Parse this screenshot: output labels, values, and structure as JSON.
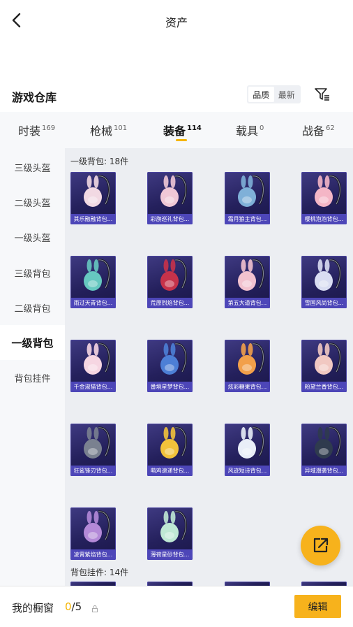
{
  "header": {
    "title": "资产"
  },
  "section": {
    "title": "游戏仓库",
    "sort_options": [
      {
        "label": "品质",
        "active": true
      },
      {
        "label": "最新",
        "active": false
      }
    ]
  },
  "tabs": [
    {
      "label": "时装",
      "count": "169"
    },
    {
      "label": "枪械",
      "count": "101"
    },
    {
      "label": "装备",
      "count": "114",
      "active": true
    },
    {
      "label": "载具",
      "count": "0"
    },
    {
      "label": "战备",
      "count": "62"
    }
  ],
  "sidebar": [
    {
      "label": "三级头盔"
    },
    {
      "label": "二级头盔"
    },
    {
      "label": "一级头盔"
    },
    {
      "label": "三级背包"
    },
    {
      "label": "二级背包"
    },
    {
      "label": "一级背包",
      "active": true
    },
    {
      "label": "背包挂件"
    }
  ],
  "groups": {
    "backpacks": {
      "label": "一级背包: 18件",
      "items": [
        {
          "name": "其乐融融背包...",
          "accent": "#f2d9e3"
        },
        {
          "name": "彩旗巡礼背包...",
          "accent": "#f0c8d6"
        },
        {
          "name": "霜月狼主背包...",
          "accent": "#7fb0d8"
        },
        {
          "name": "樱桃泡泡背包...",
          "accent": "#f4b6c6"
        },
        {
          "name": "雨过天青背包...",
          "accent": "#66c8c0"
        },
        {
          "name": "荒原烈焰背包...",
          "accent": "#c6324a"
        },
        {
          "name": "第五大道背包...",
          "accent": "#f2c2cf"
        },
        {
          "name": "雪国风尚背包...",
          "accent": "#d9ddf2"
        },
        {
          "name": "千金淑猫背包...",
          "accent": "#f6d6e2"
        },
        {
          "name": "番境星梦背包...",
          "accent": "#4d7fd6"
        },
        {
          "name": "炫彩糖果背包...",
          "accent": "#f2a04a"
        },
        {
          "name": "粉黛兰香背包...",
          "accent": "#f1c8c2"
        },
        {
          "name": "狂鲨锋刃背包...",
          "accent": "#7a8190"
        },
        {
          "name": "萌鸡速递背包...",
          "accent": "#f2c23b"
        },
        {
          "name": "风迹短诗背包...",
          "accent": "#e9eef8"
        },
        {
          "name": "异域潮袭背包...",
          "accent": "#2f3b4e"
        },
        {
          "name": "凌霄紫焰背包...",
          "accent": "#b48ad8"
        },
        {
          "name": "薄荷星砂背包...",
          "accent": "#bfe8d4"
        }
      ]
    },
    "pendants": {
      "label": "背包挂件: 14件"
    }
  },
  "bottom": {
    "window_label": "我的橱窗",
    "window_current": "0",
    "window_total": "/5",
    "edit_label": "编辑"
  },
  "colors": {
    "accent": "#f7b21c",
    "card_label_bg": "#4d46b8"
  }
}
